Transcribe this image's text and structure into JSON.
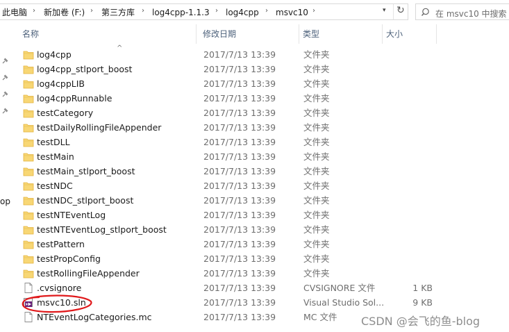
{
  "breadcrumbs": [
    "此电脑",
    "新加卷 (F:)",
    "第三方库",
    "log4cpp-1.1.3",
    "log4cpp",
    "msvc10"
  ],
  "search": {
    "placeholder": "在 msvc10 中搜索"
  },
  "nav_fragment": "op",
  "columns": {
    "name": "名称",
    "date": "修改日期",
    "type": "类型",
    "size": "大小"
  },
  "files": [
    {
      "name": "log4cpp",
      "date": "2017/7/13 13:39",
      "type": "文件夹",
      "size": "",
      "icon": "folder-icon"
    },
    {
      "name": "log4cpp_stlport_boost",
      "date": "2017/7/13 13:39",
      "type": "文件夹",
      "size": "",
      "icon": "folder-icon"
    },
    {
      "name": "log4cppLIB",
      "date": "2017/7/13 13:39",
      "type": "文件夹",
      "size": "",
      "icon": "folder-icon"
    },
    {
      "name": "log4cppRunnable",
      "date": "2017/7/13 13:39",
      "type": "文件夹",
      "size": "",
      "icon": "folder-icon"
    },
    {
      "name": "testCategory",
      "date": "2017/7/13 13:39",
      "type": "文件夹",
      "size": "",
      "icon": "folder-icon"
    },
    {
      "name": "testDailyRollingFileAppender",
      "date": "2017/7/13 13:39",
      "type": "文件夹",
      "size": "",
      "icon": "folder-icon"
    },
    {
      "name": "testDLL",
      "date": "2017/7/13 13:39",
      "type": "文件夹",
      "size": "",
      "icon": "folder-icon"
    },
    {
      "name": "testMain",
      "date": "2017/7/13 13:39",
      "type": "文件夹",
      "size": "",
      "icon": "folder-icon"
    },
    {
      "name": "testMain_stlport_boost",
      "date": "2017/7/13 13:39",
      "type": "文件夹",
      "size": "",
      "icon": "folder-icon"
    },
    {
      "name": "testNDC",
      "date": "2017/7/13 13:39",
      "type": "文件夹",
      "size": "",
      "icon": "folder-icon"
    },
    {
      "name": "testNDC_stlport_boost",
      "date": "2017/7/13 13:39",
      "type": "文件夹",
      "size": "",
      "icon": "folder-icon"
    },
    {
      "name": "testNTEventLog",
      "date": "2017/7/13 13:39",
      "type": "文件夹",
      "size": "",
      "icon": "folder-icon"
    },
    {
      "name": "testNTEventLog_stlport_boost",
      "date": "2017/7/13 13:39",
      "type": "文件夹",
      "size": "",
      "icon": "folder-icon"
    },
    {
      "name": "testPattern",
      "date": "2017/7/13 13:39",
      "type": "文件夹",
      "size": "",
      "icon": "folder-icon"
    },
    {
      "name": "testPropConfig",
      "date": "2017/7/13 13:39",
      "type": "文件夹",
      "size": "",
      "icon": "folder-icon"
    },
    {
      "name": "testRollingFileAppender",
      "date": "2017/7/13 13:39",
      "type": "文件夹",
      "size": "",
      "icon": "folder-icon"
    },
    {
      "name": ".cvsignore",
      "date": "2017/7/13 13:39",
      "type": "CVSIGNORE 文件",
      "size": "1 KB",
      "icon": "file-icon"
    },
    {
      "name": "msvc10.sln",
      "date": "2017/7/13 13:39",
      "type": "Visual Studio Sol...",
      "size": "9 KB",
      "icon": "visual-studio-solution-icon"
    },
    {
      "name": "NTEventLogCategories.mc",
      "date": "2017/7/13 13:39",
      "type": "MC 文件",
      "size": "",
      "icon": "file-icon"
    }
  ],
  "watermark": "CSDN @会飞的鱼-blog",
  "colors": {
    "folder": "#f8d775",
    "folder_dark": "#e3b33d",
    "header_text": "#4c607a",
    "annotation": "#e0191b"
  }
}
